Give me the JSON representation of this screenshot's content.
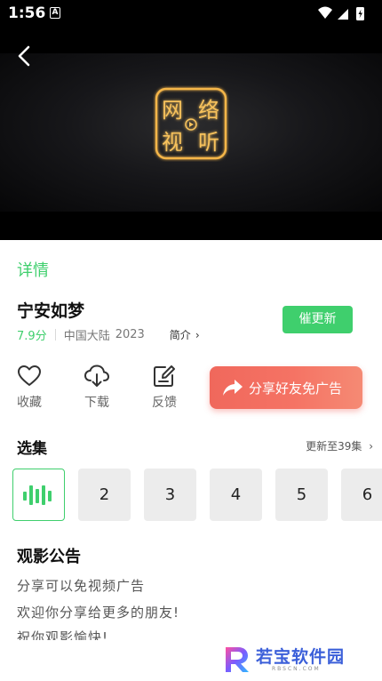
{
  "status_bar": {
    "time": "1:56",
    "notification_letter": "A"
  },
  "video": {
    "logo_chars": [
      "网",
      "络",
      "视",
      "听"
    ],
    "colors": {
      "glow": "#f5b64a",
      "bg": "#000000"
    }
  },
  "detail": {
    "tab_label": "详情",
    "title": "宁安如梦",
    "score": "7.9分",
    "region": "中国大陆",
    "year": "2023",
    "intro_label": "简介",
    "chevron": "›",
    "update_button": "催更新"
  },
  "actions": [
    {
      "label": "收藏",
      "icon": "heart-icon"
    },
    {
      "label": "下载",
      "icon": "cloud-download-icon"
    },
    {
      "label": "反馈",
      "icon": "edit-icon"
    }
  ],
  "share_button": {
    "label": "分享好友免广告",
    "icon": "share-arrow-icon"
  },
  "episodes": {
    "section_title": "选集",
    "more_label": "更新至39集",
    "chevron": "›",
    "items": [
      "",
      "2",
      "3",
      "4",
      "5",
      "6"
    ],
    "active_index": 0
  },
  "notice": {
    "title": "观影公告",
    "lines": [
      "分享可以免视频广告",
      "欢迎你分享给更多的朋友!",
      "祝你观影愉快!"
    ]
  },
  "watermark": {
    "text": "若宝软件园",
    "sub": "RBSCN.COM"
  },
  "colors": {
    "accent": "#3fcf6d",
    "share_gradient_start": "#f0685c",
    "share_gradient_end": "#f58a74"
  }
}
